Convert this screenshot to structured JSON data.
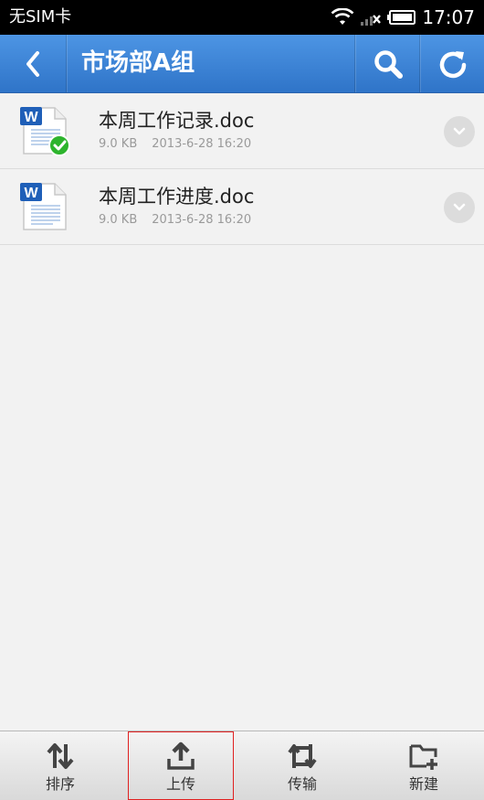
{
  "status_bar": {
    "carrier": "无SIM卡",
    "time": "17:07"
  },
  "header": {
    "title": "市场部A组",
    "back_icon": "chevron-left-icon",
    "search_icon": "search-icon",
    "refresh_icon": "refresh-icon"
  },
  "files": [
    {
      "name": "本周工作记录.doc",
      "size": "9.0 KB",
      "date": "2013-6-28 16:20",
      "synced": true
    },
    {
      "name": "本周工作进度.doc",
      "size": "9.0 KB",
      "date": "2013-6-28 16:20",
      "synced": false
    }
  ],
  "toolbar": {
    "sort": "排序",
    "upload": "上传",
    "transfer": "传输",
    "new": "新建"
  },
  "colors": {
    "header": "#3a82d6",
    "synced_badge": "#2db42d",
    "word_blue": "#1f5fb8",
    "selected_outline": "#e02020"
  }
}
